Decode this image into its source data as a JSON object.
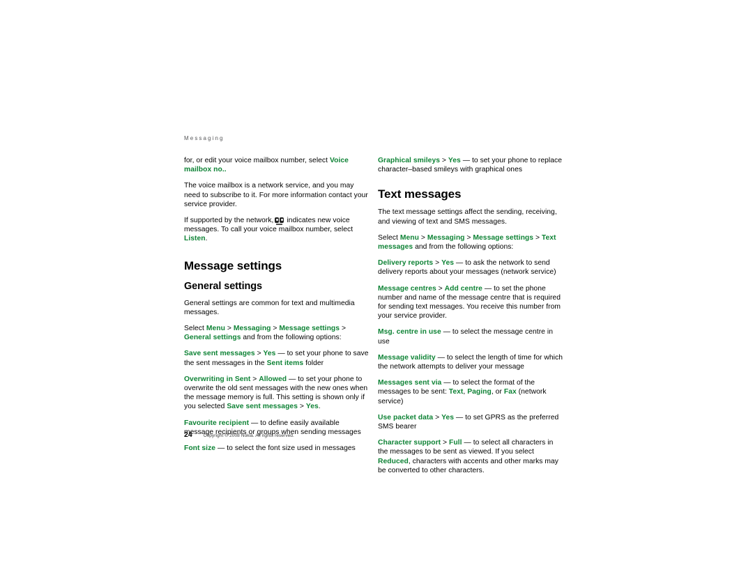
{
  "page": {
    "running_head": "Messaging",
    "folio": "24",
    "copyright": "Copyright © 2008 Nokia. All rights reserved."
  },
  "left_column": {
    "para_voicemail_edit": {
      "pre": "for, or edit your voice mailbox number, select ",
      "term": "Voice mailbox no.."
    },
    "para_network_service": "The voice mailbox is a network service, and you may need to subscribe to it. For more information contact your service provider.",
    "para_supported": {
      "pre": "If supported by the network,",
      "icon": "voicemail-icon",
      "mid": "indicates new voice messages. To call your voice mailbox number, select ",
      "term": "Listen",
      "post": "."
    },
    "heading_message_settings": "Message settings",
    "heading_general_settings": "General settings",
    "para_general_common": "General settings are common for text and multimedia messages.",
    "path_general": {
      "select": "Select ",
      "menu": "Menu",
      "sep1": " > ",
      "messaging": "Messaging",
      "sep2": " > ",
      "message_settings": "Message settings",
      "sep3": " > ",
      "general_settings": "General settings",
      "tail": " and from the following options:"
    },
    "options": [
      {
        "term": "Save sent messages",
        "sep": " > ",
        "value": "Yes",
        "dash": " — ",
        "desc_pre": "to set your phone to save the sent messages in the ",
        "inline_term": "Sent items",
        "desc_post": " folder"
      },
      {
        "term": "Overwriting in Sent",
        "sep": " > ",
        "value": "Allowed",
        "dash": " — ",
        "desc_pre": "to set your phone to overwrite the old sent messages with the new ones when the message memory is full. This setting is shown only if you selected ",
        "inline_term": "Save sent messages",
        "inline_sep": " > ",
        "inline_value": "Yes",
        "desc_post": "."
      },
      {
        "term": "Favourite recipient",
        "dash": " — ",
        "desc_pre": "to define easily available message recipients or groups when sending messages"
      },
      {
        "term": "Font size",
        "dash": " — ",
        "desc_pre": "to select the font size used in messages"
      }
    ]
  },
  "right_column": {
    "option_graphical_smileys": {
      "term": "Graphical smileys",
      "sep": " > ",
      "value": "Yes",
      "dash": " — ",
      "desc": "to set your phone to replace character–based smileys with graphical ones"
    },
    "heading_text_messages": "Text messages",
    "para_text_settings": "The text message settings affect the sending, receiving, and viewing of text and SMS messages.",
    "path_text": {
      "select": "Select ",
      "menu": "Menu",
      "sep1": " > ",
      "messaging": "Messaging",
      "sep2": " > ",
      "message_settings": "Message settings",
      "sep3": " > ",
      "text_messages": "Text messages",
      "tail": " and from the following options:"
    },
    "options": [
      {
        "term": "Delivery reports",
        "sep": " > ",
        "value": "Yes",
        "dash": " — ",
        "desc": "to ask the network to send delivery reports about your messages (network service)"
      },
      {
        "term": "Message centres",
        "sep": " > ",
        "value": "Add centre",
        "dash": " — ",
        "desc": "to set the phone number and name of the message centre that is required for sending text messages. You receive this number from your service provider."
      },
      {
        "term": "Msg. centre in use",
        "dash": " — ",
        "desc": "to select the message centre in use"
      },
      {
        "term": "Message validity",
        "dash": " — ",
        "desc": "to select the length of time for which the network attempts to deliver your message"
      }
    ],
    "option_messages_sent_via": {
      "term": "Messages sent via",
      "dash": " — ",
      "desc_pre": "to select the format of the messages to be sent: ",
      "v1": "Text",
      "c1": ", ",
      "v2": "Paging",
      "c2": ", or ",
      "v3": "Fax",
      "desc_post": " (network service)"
    },
    "option_use_packet_data": {
      "term": "Use packet data",
      "sep": " > ",
      "value": "Yes",
      "dash": " — ",
      "desc": "to set GPRS as the preferred SMS bearer"
    },
    "option_character_support": {
      "term": "Character support",
      "sep": " > ",
      "value": "Full",
      "dash": " — ",
      "desc_pre": "to select all characters in the messages to be sent as viewed. If you select ",
      "inline_value": "Reduced",
      "desc_post": ", characters with accents and other marks may be converted to other characters."
    }
  },
  "colors": {
    "accent_green": "#0f8336",
    "body_text": "#000000",
    "running_head": "#58595b"
  }
}
